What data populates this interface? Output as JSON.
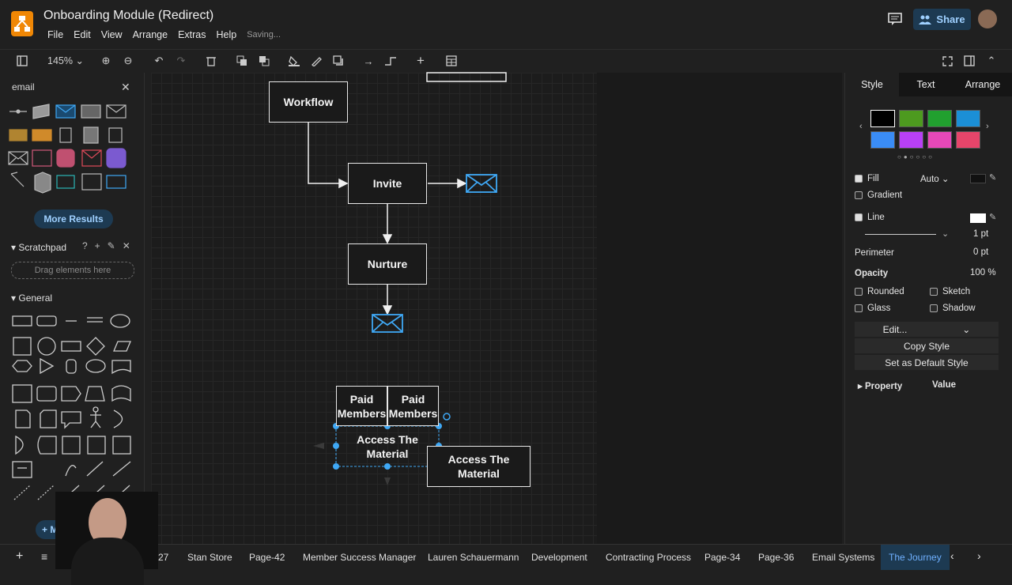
{
  "window": {
    "title": "Onboarding Module (Redirect)",
    "saving": "Saving...",
    "share_label": "Share"
  },
  "menu": [
    "File",
    "Edit",
    "View",
    "Arrange",
    "Extras",
    "Help"
  ],
  "toolbar": {
    "zoom": "145%"
  },
  "left_panel": {
    "search_value": "email",
    "more_results": "More Results",
    "scratchpad_title": "Scratchpad",
    "scratchpad_hint": "Drag elements here",
    "general_title": "General",
    "more_shapes": "+ More Shapes"
  },
  "diagram": {
    "workflow": "Workflow",
    "invite": "Invite",
    "nurture": "Nurture",
    "paid_members_1": "Paid Members",
    "paid_members_2": "Paid Members",
    "access_1": "Access The Material",
    "access_2": "Access The Material"
  },
  "right_panel": {
    "tabs": [
      "Style",
      "Text",
      "Arrange"
    ],
    "fill": "Fill",
    "fill_mode": "Auto",
    "gradient": "Gradient",
    "line": "Line",
    "line_width": "1 pt",
    "perimeter": "Perimeter",
    "perimeter_value": "0 pt",
    "opacity": "Opacity",
    "opacity_value": "100 %",
    "rounded": "Rounded",
    "sketch": "Sketch",
    "glass": "Glass",
    "shadow": "Shadow",
    "edit": "Edit...",
    "copy_style": "Copy Style",
    "default_style": "Set as Default Style",
    "property": "Property",
    "value": "Value",
    "swatches": [
      "#000000",
      "#4d9a1f",
      "#21a02f",
      "#1b8fd6",
      "#3a8cf5",
      "#b840f5",
      "#e648b8",
      "#e6456a"
    ]
  },
  "pages": {
    "partial": "27",
    "tabs": [
      "Stan Store",
      "Page-42",
      "Member Success Manager",
      "Lauren Schauermann",
      "Development",
      "Contracting Process",
      "Page-34",
      "Page-36",
      "Email Systems",
      "The Journey"
    ]
  }
}
